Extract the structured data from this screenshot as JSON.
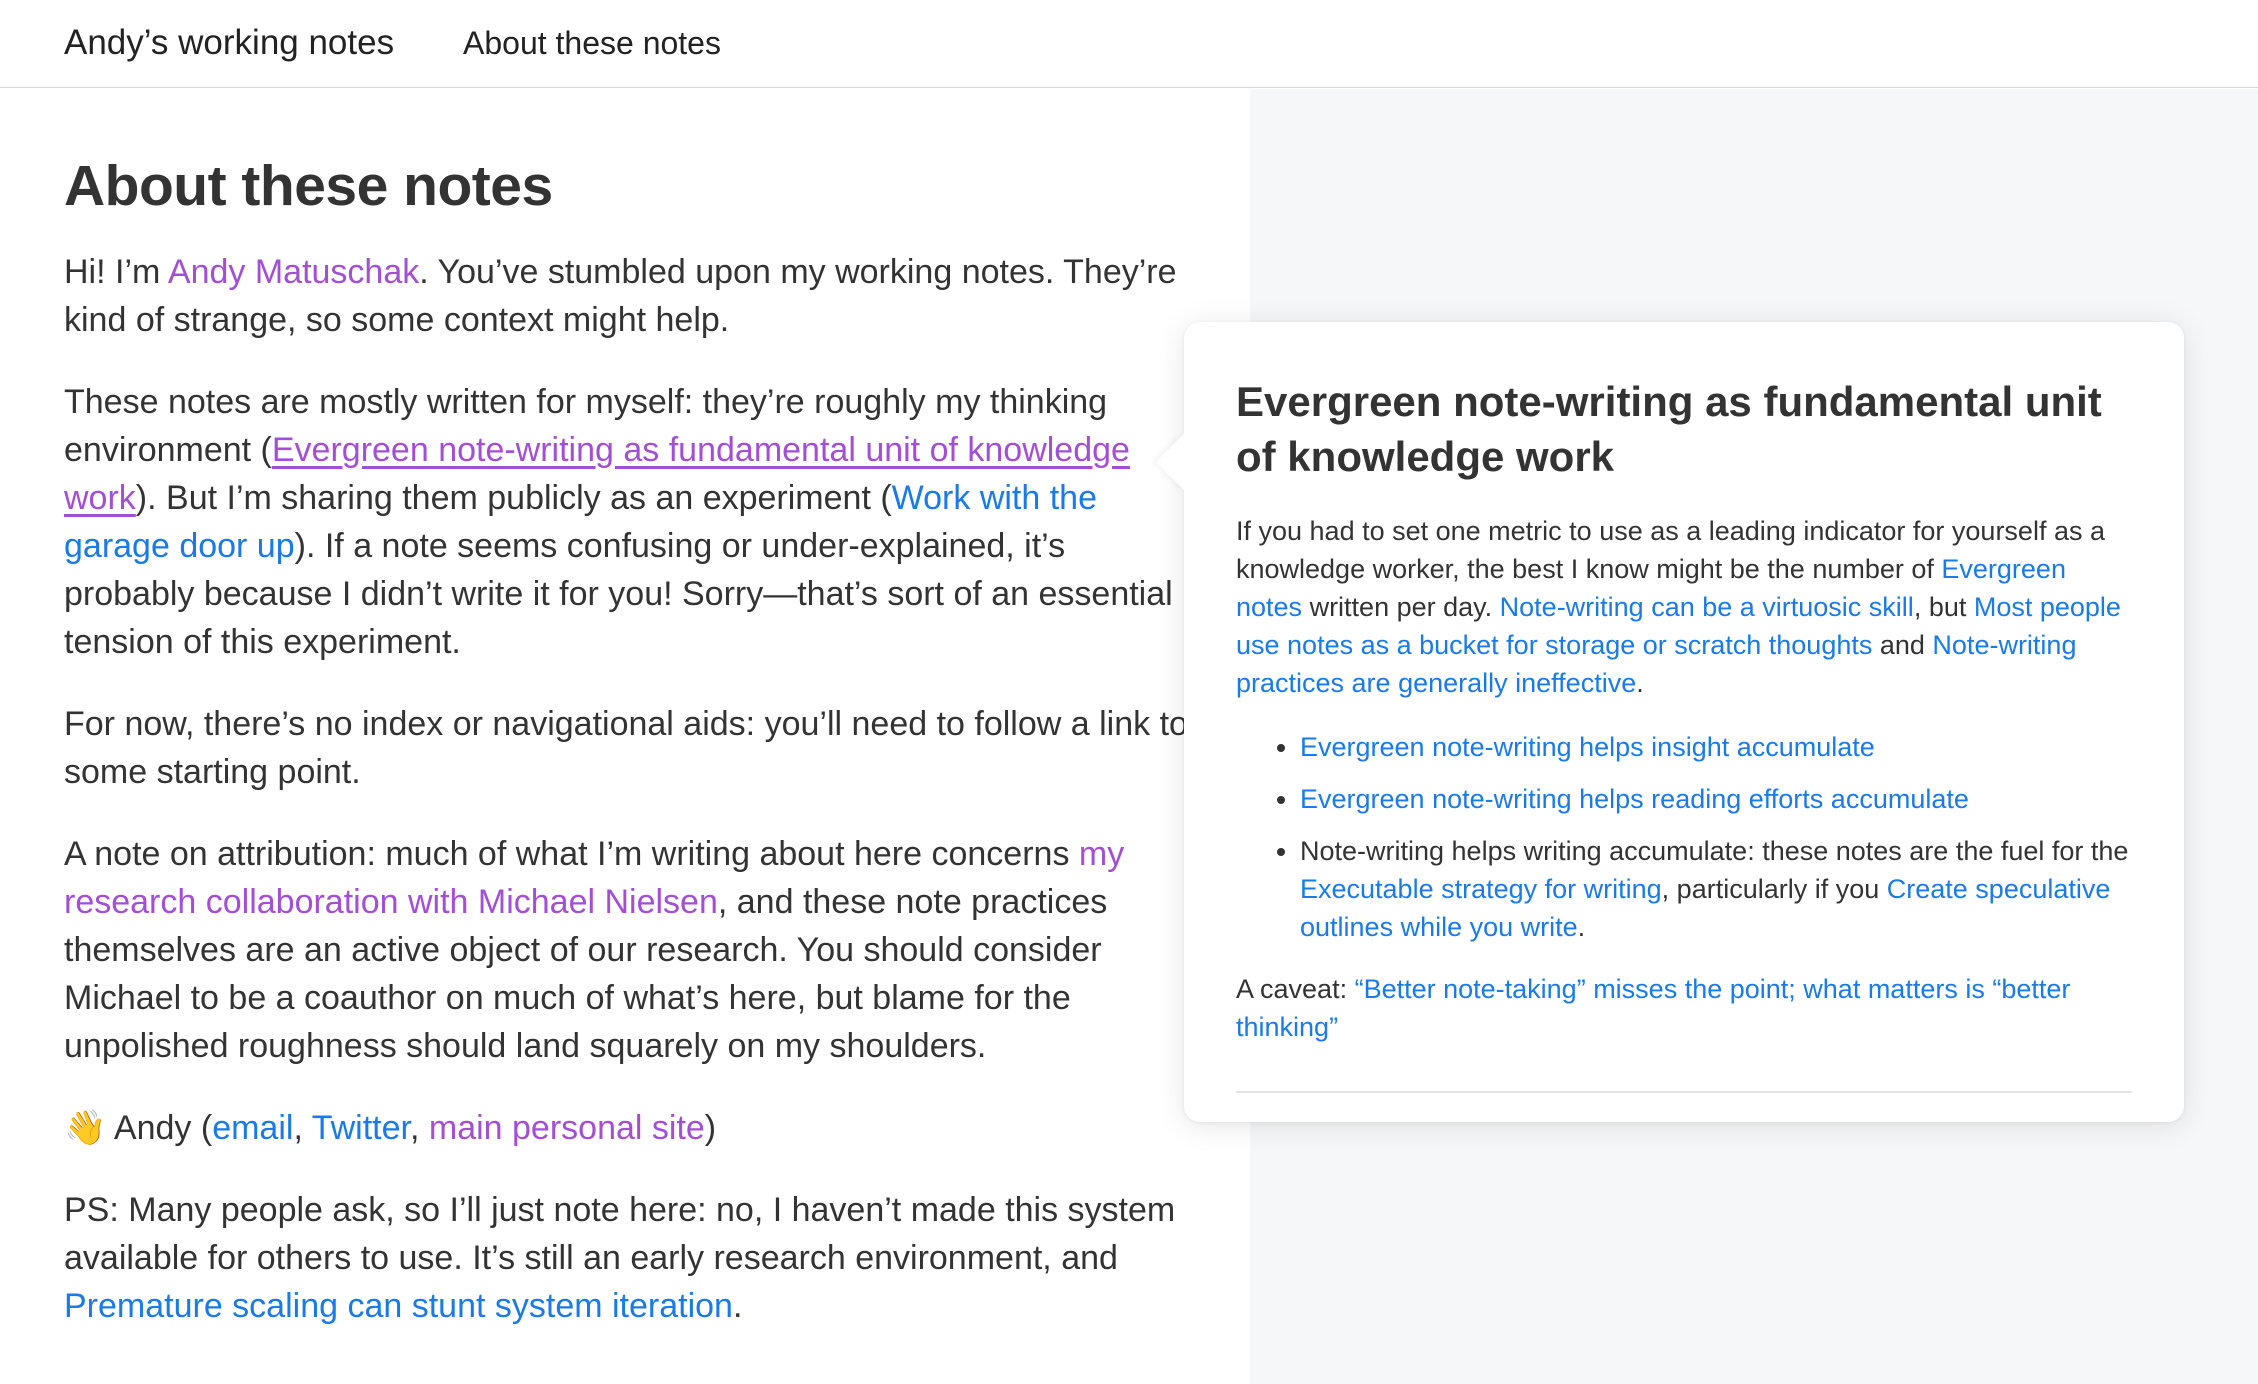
{
  "header": {
    "site_title": "Andy’s working notes",
    "nav_about": "About these notes"
  },
  "main": {
    "title": "About these notes",
    "p1": {
      "t1": "Hi! I’m ",
      "link_andy": "Andy Matuschak",
      "t2": ". You’ve stumbled upon my working notes. They’re kind of strange, so some context might help."
    },
    "p2": {
      "t1": "These notes are mostly written for myself: they’re roughly my thinking environment (",
      "link_evergreen": "Evergreen note-writing as fundamental unit of knowledge work",
      "t2": "). But I’m sharing them publicly as an experiment (",
      "link_garage": "Work with the garage door up",
      "t3": "). If a note seems confusing or under-explained, it’s probably because I didn’t write it for you! Sorry—that’s sort of an essential tension of this experiment."
    },
    "p3": {
      "t1": "For now, there’s no index or navigational aids: you’ll need to follow a link to some starting point."
    },
    "p4": {
      "t1": "A note on attribution: much of what I’m writing about here concerns ",
      "link_research": "my research collaboration with Michael Nielsen",
      "t2": ", and these note practices themselves are an active object of our research. You should consider Michael to be a coauthor on much of what’s here, but blame for the unpolished roughness should land squarely on my shoulders."
    },
    "p5": {
      "wave": "👋",
      "t1": " Andy (",
      "link_email": "email",
      "sep1": ", ",
      "link_twitter": "Twitter",
      "sep2": ", ",
      "link_site": "main personal site",
      "t2": ")"
    },
    "p6": {
      "t1": "PS: Many people ask, so I’ll just note here: no, I haven’t made this system available for others to use. It’s still an early research environment, and ",
      "link_premature": "Premature scaling can stunt system iteration",
      "t2": "."
    }
  },
  "popup": {
    "title": "Evergreen note-writing as fundamental unit of knowledge work",
    "p1": {
      "t1": "If you had to set one metric to use as a leading indicator for yourself as a knowledge worker, the best I know might be the number of ",
      "link_evergreen_notes": "Evergreen notes",
      "t2": " written per day. ",
      "link_virtuosic": "Note-writing can be a virtuosic skill",
      "t3": ", but ",
      "link_bucket": "Most people use notes as a bucket for storage or scratch thoughts",
      "t4": " and ",
      "link_ineffective": "Note-writing practices are generally ineffective",
      "t5": "."
    },
    "list": {
      "item1_link": "Evergreen note-writing helps insight accumulate",
      "item2_link": "Evergreen note-writing helps reading efforts accumulate",
      "item3_t1": "Note-writing helps writing accumulate: these notes are the fuel for the ",
      "item3_link1": "Executable strategy for writing",
      "item3_t2": ", particularly if you ",
      "item3_link2": "Create speculative outlines while you write",
      "item3_t3": "."
    },
    "caveat": {
      "t1": "A caveat: ",
      "link": "“Better note-taking” misses the point; what matters is “better thinking”"
    }
  },
  "colors": {
    "link": "#1a7ae8",
    "visited_link": "#a24fd6",
    "text": "#333333",
    "right_panel_bg": "#f6f7f9"
  }
}
